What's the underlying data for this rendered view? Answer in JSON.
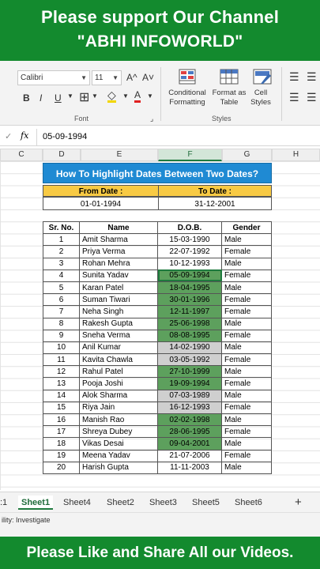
{
  "banners": {
    "top_line1": "Please support Our Channel",
    "top_line2": "\"ABHI INFOWORLD\"",
    "bottom": "Please Like and Share All our Videos."
  },
  "ribbon": {
    "font_name": "Calibri",
    "font_size": "11",
    "grow_font": "A^",
    "shrink_font": "A˅",
    "bold": "B",
    "italic": "I",
    "underline": "U",
    "font_color": "A",
    "font_group_label": "Font",
    "conditional_formatting": "Conditional Formatting",
    "format_as_table": "Format as Table",
    "cell_styles": "Cell Styles",
    "styles_group_label": "Styles"
  },
  "formula_bar": {
    "fx": "fx",
    "value": "05-09-1994"
  },
  "columns": [
    "C",
    "D",
    "E",
    "F",
    "G",
    "H"
  ],
  "selected_column": "F",
  "sheet": {
    "title": "How To Highlight Dates Between Two Dates?",
    "from_label": "From Date :",
    "to_label": "To Date :",
    "from_value": "01-01-1994",
    "to_value": "31-12-2001",
    "headers": [
      "Sr. No.",
      "Name",
      "D.O.B.",
      "Gender"
    ],
    "rows": [
      {
        "sr": "1",
        "name": "Amit Sharma",
        "dob": "15-03-1990",
        "gender": "Male",
        "hl": "none"
      },
      {
        "sr": "2",
        "name": "Priya Verma",
        "dob": "22-07-1992",
        "gender": "Female",
        "hl": "none"
      },
      {
        "sr": "3",
        "name": "Rohan Mehra",
        "dob": "10-12-1993",
        "gender": "Male",
        "hl": "none"
      },
      {
        "sr": "4",
        "name": "Sunita Yadav",
        "dob": "05-09-1994",
        "gender": "Female",
        "hl": "green"
      },
      {
        "sr": "5",
        "name": "Karan Patel",
        "dob": "18-04-1995",
        "gender": "Male",
        "hl": "green"
      },
      {
        "sr": "6",
        "name": "Suman Tiwari",
        "dob": "30-01-1996",
        "gender": "Female",
        "hl": "green"
      },
      {
        "sr": "7",
        "name": "Neha Singh",
        "dob": "12-11-1997",
        "gender": "Female",
        "hl": "green"
      },
      {
        "sr": "8",
        "name": "Rakesh Gupta",
        "dob": "25-06-1998",
        "gender": "Male",
        "hl": "green"
      },
      {
        "sr": "9",
        "name": "Sneha Verma",
        "dob": "08-08-1995",
        "gender": "Female",
        "hl": "green"
      },
      {
        "sr": "10",
        "name": "Anil Kumar",
        "dob": "14-02-1990",
        "gender": "Male",
        "hl": "grey"
      },
      {
        "sr": "11",
        "name": "Kavita Chawla",
        "dob": "03-05-1992",
        "gender": "Female",
        "hl": "grey"
      },
      {
        "sr": "12",
        "name": "Rahul Patel",
        "dob": "27-10-1999",
        "gender": "Male",
        "hl": "green"
      },
      {
        "sr": "13",
        "name": "Pooja Joshi",
        "dob": "19-09-1994",
        "gender": "Female",
        "hl": "green"
      },
      {
        "sr": "14",
        "name": "Alok Sharma",
        "dob": "07-03-1989",
        "gender": "Male",
        "hl": "grey"
      },
      {
        "sr": "15",
        "name": "Riya Jain",
        "dob": "16-12-1993",
        "gender": "Female",
        "hl": "grey"
      },
      {
        "sr": "16",
        "name": "Manish Rao",
        "dob": "02-02-1998",
        "gender": "Male",
        "hl": "green"
      },
      {
        "sr": "17",
        "name": "Shreya Dubey",
        "dob": "28-06-1995",
        "gender": "Female",
        "hl": "green"
      },
      {
        "sr": "18",
        "name": "Vikas Desai",
        "dob": "09-04-2001",
        "gender": "Male",
        "hl": "green"
      },
      {
        "sr": "19",
        "name": "Meena Yadav",
        "dob": "21-07-2006",
        "gender": "Female",
        "hl": "none"
      },
      {
        "sr": "20",
        "name": "Harish Gupta",
        "dob": "11-11-2003",
        "gender": "Male",
        "hl": "none"
      }
    ]
  },
  "tabs": {
    "partial": ":1",
    "items": [
      "Sheet1",
      "Sheet4",
      "Sheet2",
      "Sheet3",
      "Sheet5",
      "Sheet6"
    ],
    "active": "Sheet1",
    "add": "+"
  },
  "status": "ility: Investigate",
  "colors": {
    "banner_green": "#138a2e",
    "title_blue": "#1f8ad3",
    "header_yellow": "#f8ca44",
    "highlight_green": "#5da05d",
    "grey_fill": "#cfcfcf"
  }
}
